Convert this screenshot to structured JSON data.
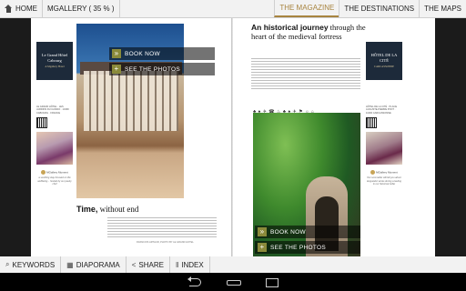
{
  "topbar": {
    "home_label": "HOME",
    "gallery_label": "MGALLERY ( 35 % )",
    "tabs": [
      {
        "label": "THE MAGAZINE",
        "active": true
      },
      {
        "label": "THE DESTINATIONS",
        "active": false
      },
      {
        "label": "THE MAPS",
        "active": false
      }
    ]
  },
  "left_page": {
    "hotel_ad": {
      "logo_text": "Le Grand Hôtel Cabourg",
      "logo_sub": "A Mgallery Hotel",
      "address": "LE GRAND HÔTEL · LES JARDINS DU CASINO · 14390 CABOURG · FRANCE",
      "caption": "a soothing stay focused on the wellbeing... hosted by our pastry chef"
    },
    "buttons": {
      "book_now": "BOOK NOW",
      "see_photos": "SEE THE PHOTOS"
    },
    "article_title_bold": "Time,",
    "article_title_rest": " without end",
    "credit": "FRANCOIS ARTHUR, PHOTO BY LE GRAND HOTEL"
  },
  "right_page": {
    "article_title_bold": "An historical journey",
    "article_title_rest": " through the heart of the medieval fortress",
    "icons": "♣ ♠ ✈ ☎ ♨ ♣ ♠ ✈ ⚑ ☼ ⌂",
    "buttons": {
      "book_now": "BOOK NOW",
      "see_photos": "SEE THE PHOTOS"
    },
    "hotel_ad": {
      "logo_text": "HÔTEL DE LA CITÉ",
      "logo_sub": "CARCASSONNE",
      "address": "HÔTEL DE LA CITÉ · PLACE AUGUSTE-PIERRE PONT · 11000 CARCASSONNE",
      "caption": "Our sommelier will tell you about languedoc wines during a tasting in our historical cellar"
    }
  },
  "mgallery_mark": "MGallery Moment",
  "bottombar": {
    "items": [
      {
        "icon": "⌕",
        "label": "KEYWORDS"
      },
      {
        "icon": "▦",
        "label": "DIAPORAMA"
      },
      {
        "icon": "<",
        "label": "SHARE"
      },
      {
        "icon": "‖",
        "label": "INDEX"
      }
    ]
  },
  "colors": {
    "accent": "#a8843f",
    "bar_bg": "#f2f2f2"
  }
}
